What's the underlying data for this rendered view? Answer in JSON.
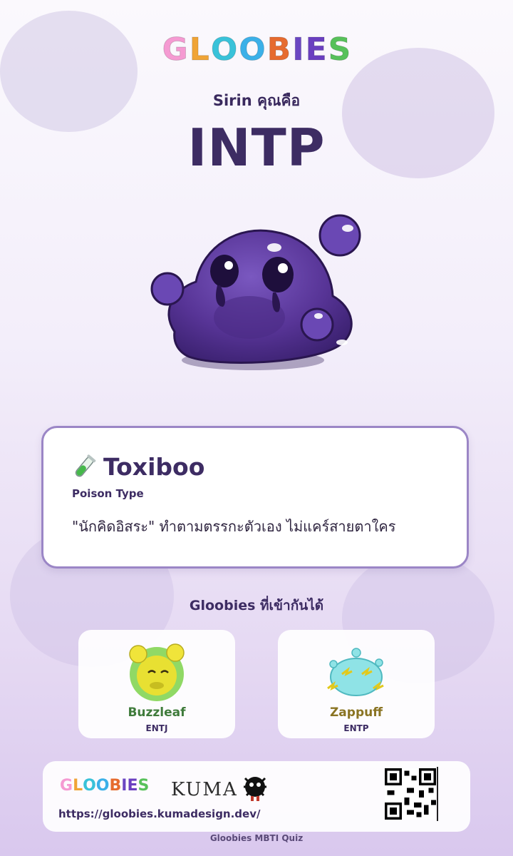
{
  "brand": {
    "logo_letters": [
      "G",
      "L",
      "O",
      "O",
      "B",
      "I",
      "E",
      "S"
    ],
    "logo_colors": [
      "#f59ad2",
      "#f0a436",
      "#39c2d9",
      "#3bb0e8",
      "#e66b2f",
      "#6a46c2",
      "#6a3fc0",
      "#57c15a"
    ],
    "footer_logo_letters": [
      "G",
      "L",
      "O",
      "O",
      "B",
      "I",
      "E",
      "S"
    ]
  },
  "result": {
    "subtitle": "Sirin คุณคือ",
    "mbti": "INTP",
    "slime_icon": "purple-slime",
    "name": "Toxiboo",
    "element": "Poison Type",
    "description": "\"นักคิดอิสระ\" ทำตามตรรกะตัวเอง ไม่แคร์สายตาใคร",
    "element_icon": "test-tube-icon"
  },
  "compatible": {
    "title": "Gloobies ที่เข้ากันได้",
    "items": [
      {
        "name": "Buzzleaf",
        "mbti": "ENTJ",
        "icon": "yellow-green-slime"
      },
      {
        "name": "Zappuff",
        "mbti": "ENTP",
        "icon": "cyan-electric-slime"
      }
    ]
  },
  "footer": {
    "kuma_logo": "KUMA",
    "url": "https://gloobies.kumadesign.dev/",
    "qr_icon": "qr-code",
    "caption": "Gloobies MBTI Quiz"
  },
  "colors": {
    "accent": "#3d2c63",
    "card_border": "#9b86c6",
    "slime_main": "#5b3a9a"
  }
}
